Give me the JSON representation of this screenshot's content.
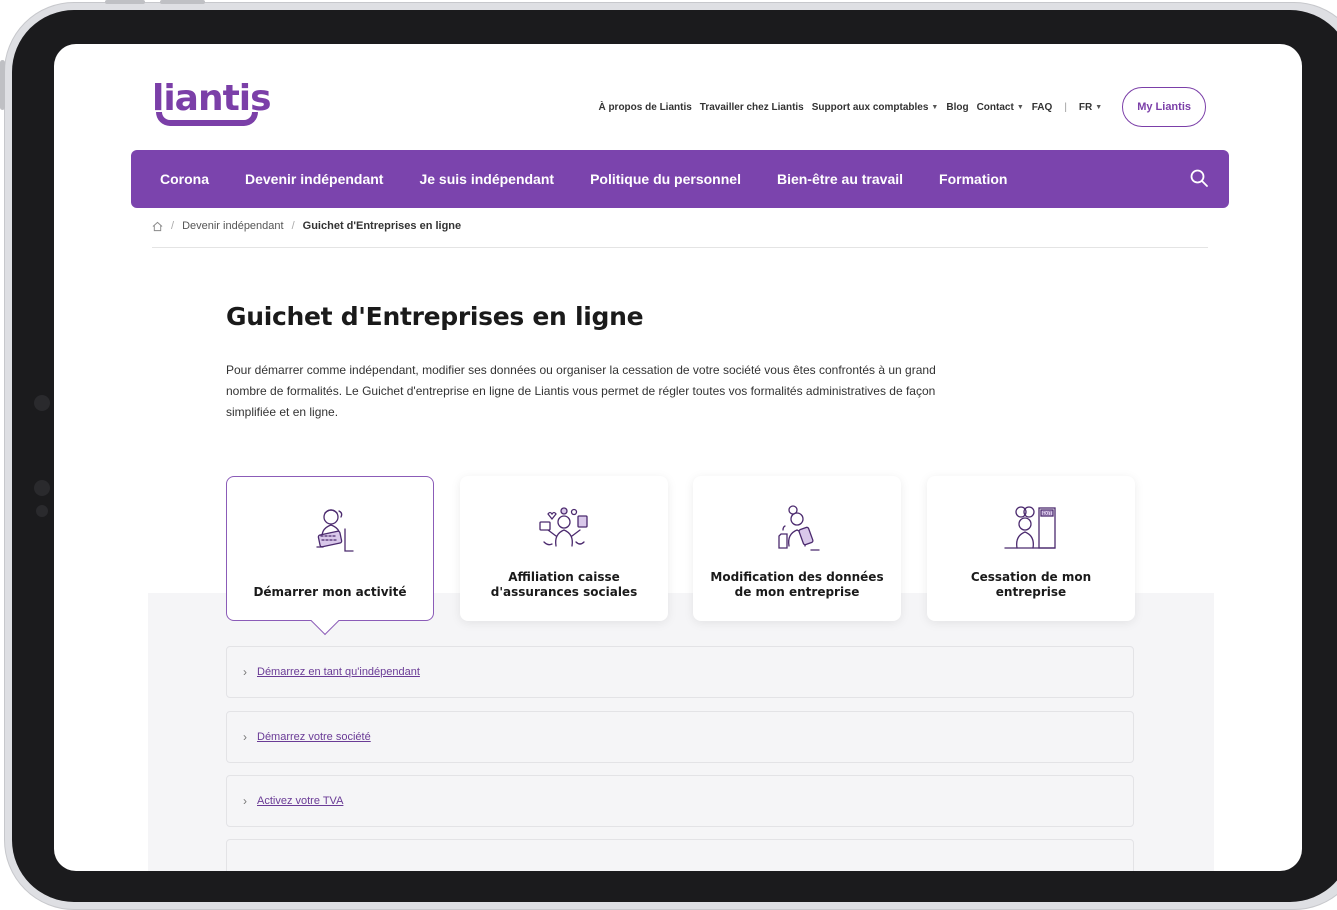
{
  "brand": {
    "logo_text": "liantis",
    "accent": "#7b44ad"
  },
  "topnav": {
    "items": [
      {
        "label": "À propos de Liantis",
        "dropdown": false
      },
      {
        "label": "Travailler chez Liantis",
        "dropdown": false
      },
      {
        "label": "Support aux comptables",
        "dropdown": true
      },
      {
        "label": "Blog",
        "dropdown": false
      },
      {
        "label": "Contact",
        "dropdown": true
      },
      {
        "label": "FAQ",
        "dropdown": false
      }
    ],
    "separator": "|",
    "language": "FR",
    "login_label": "My Liantis"
  },
  "mainnav": {
    "items": [
      "Corona",
      "Devenir indépendant",
      "Je suis indépendant",
      "Politique du personnel",
      "Bien-être au travail",
      "Formation"
    ],
    "search_icon": "search-icon"
  },
  "breadcrumb": {
    "home_icon": "home-icon",
    "separator": "/",
    "items": [
      "Devenir indépendant",
      "Guichet d'Entreprises en ligne"
    ]
  },
  "page": {
    "title": "Guichet d'Entreprises en ligne",
    "intro": "Pour démarrer comme indépendant, modifier ses données ou organiser la cessation de votre société vous êtes confrontés à un grand nombre de formalités. Le Guichet d'entreprise en ligne de Liantis vous permet de régler toutes vos formalités administratives de façon simplifiée et en ligne."
  },
  "cards": [
    {
      "label": "Démarrer mon activité",
      "icon": "person-laptop-icon",
      "active": true
    },
    {
      "label": "Affiliation caisse d'assurances sociales",
      "icon": "person-juggling-icon",
      "active": false
    },
    {
      "label": "Modification des données de mon entreprise",
      "icon": "person-tablet-icon",
      "active": false
    },
    {
      "label": "Cessation de mon entreprise",
      "icon": "person-exit-icon",
      "active": false
    }
  ],
  "accordion": [
    {
      "label": "Démarrez en tant qu'indépendant"
    },
    {
      "label": "Démarrez votre société"
    },
    {
      "label": "Activez votre TVA"
    }
  ]
}
